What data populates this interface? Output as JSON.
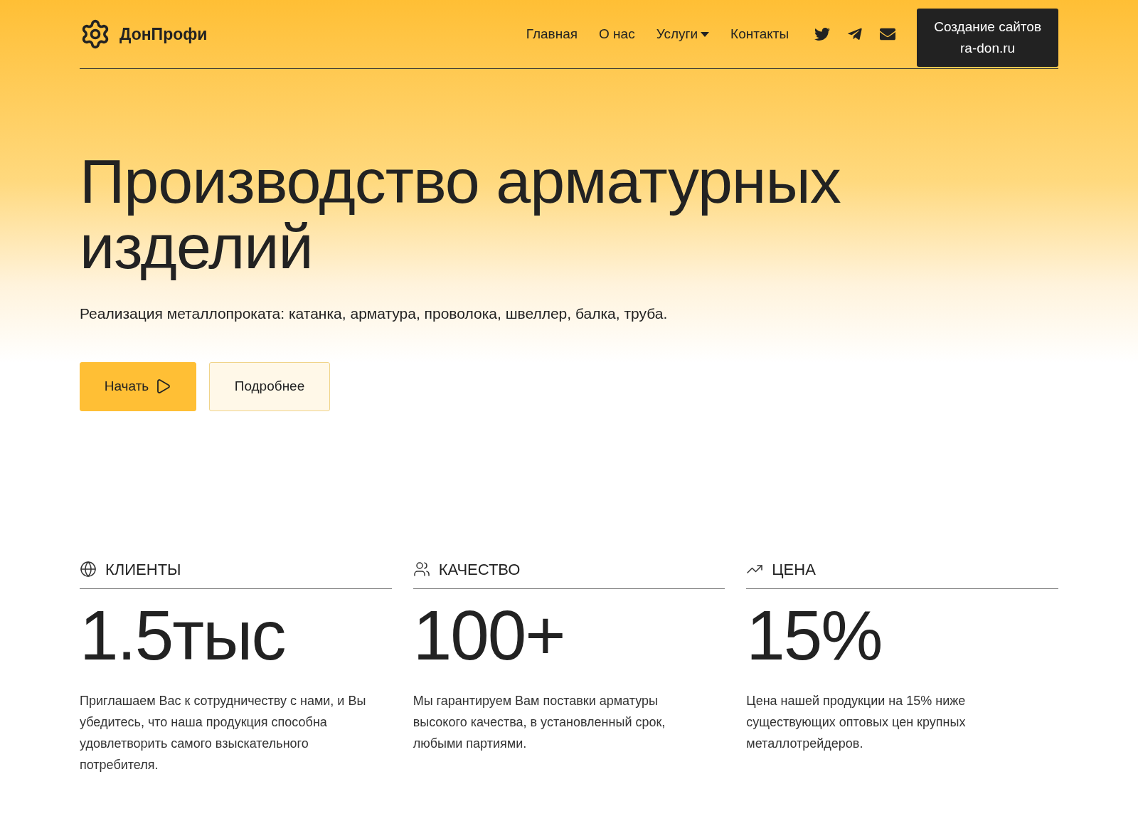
{
  "header": {
    "logo": "ДонПрофи",
    "nav": [
      {
        "label": "Главная",
        "dropdown": false
      },
      {
        "label": "О нас",
        "dropdown": false
      },
      {
        "label": "Услуги",
        "dropdown": true
      },
      {
        "label": "Контакты",
        "dropdown": false
      }
    ],
    "social": [
      {
        "kind": "twitter"
      },
      {
        "kind": "telegram"
      },
      {
        "kind": "mail"
      }
    ],
    "cta": [
      "Создание сайтов",
      "ra-don.ru"
    ]
  },
  "hero": {
    "title": "Производство арматурных изделий",
    "subtitle": "Реализация металлопроката: катанка, арматура, проволока, швеллер, балка, труба.",
    "buttons": [
      {
        "label": "Начать",
        "kind": "primary"
      },
      {
        "label": "Подробнее",
        "kind": "outline"
      }
    ]
  },
  "stats": [
    {
      "kind": "globe",
      "label": "КЛИЕНТЫ",
      "value": "1.5тыс",
      "text": "Приглашаем Вас к сотрудничеству с нами, и Вы убедитесь, что наша продукция способна удовлетворить самого взыскательного потребителя."
    },
    {
      "kind": "users",
      "label": "КАЧЕСТВО",
      "value": "100+",
      "text": "Мы гарантируем Вам поставки арматуры высокого качества, в установленный срок, любыми партиями."
    },
    {
      "kind": "trend",
      "label": "ЦЕНА",
      "value": "15%",
      "text": "Цена нашей продукции на 15% ниже существующих оптовых цен крупных металлотрейдеров."
    }
  ]
}
